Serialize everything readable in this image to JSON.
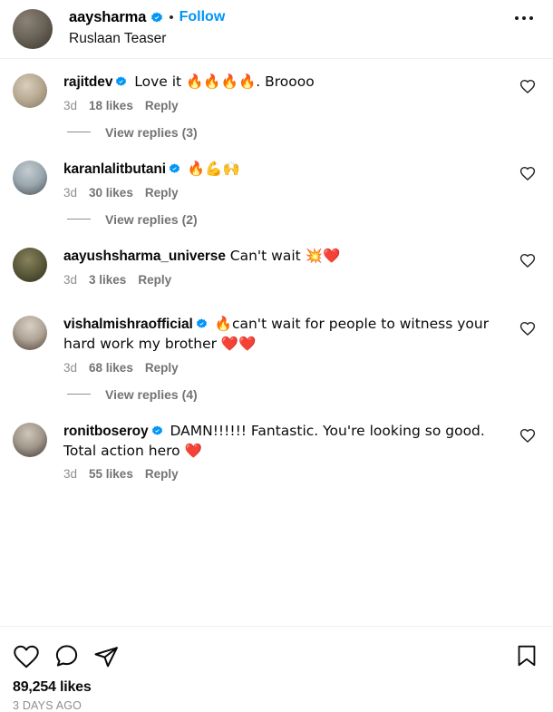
{
  "post": {
    "author": "aaysharma",
    "verified": true,
    "follow_label": "Follow",
    "separator": "•",
    "caption": "Ruslaan Teaser",
    "avatar_colors": [
      "#6b6459",
      "#3a342c",
      "#8c8276"
    ],
    "more_menu_label": "more-options"
  },
  "colors": {
    "link_blue": "#0095f6",
    "verified_blue": "#0095f6",
    "meta_gray": "#737373",
    "time_gray": "#8e8e8e",
    "divider": "#efefef",
    "text_black": "#0a0a0a"
  },
  "comments": [
    {
      "username": "rajitdev",
      "verified": true,
      "text": " Love it 🔥🔥🔥🔥. Broooo",
      "time": "3d",
      "likes": "18 likes",
      "reply": "Reply",
      "avatar_colors": [
        "#b7a890",
        "#7e7565",
        "#d9cfbd"
      ],
      "replies_label": "View replies (3)",
      "has_replies": true
    },
    {
      "username": "karanlalitbutani",
      "verified": true,
      "text": " 🔥💪🙌",
      "time": "3d",
      "likes": "30 likes",
      "reply": "Reply",
      "avatar_colors": [
        "#9aa7ae",
        "#4a4f52",
        "#c3ccd1"
      ],
      "replies_label": "View replies (2)",
      "has_replies": true
    },
    {
      "username": "aayushsharma_universe",
      "verified": false,
      "text": " Can't wait 💥❤️",
      "time": "3d",
      "likes": "3 likes",
      "reply": "Reply",
      "avatar_colors": [
        "#5b5a3a",
        "#2e2d1c",
        "#87825c"
      ],
      "replies_label": "",
      "has_replies": false
    },
    {
      "username": "vishalmishraofficial",
      "verified": true,
      "text": " 🔥can't wait for people to witness your hard work my brother ❤️❤️",
      "time": "3d",
      "likes": "68 likes",
      "reply": "Reply",
      "avatar_colors": [
        "#b0a496",
        "#4f443a",
        "#d8d0c4"
      ],
      "replies_label": "View replies (4)",
      "has_replies": true
    },
    {
      "username": "ronitboseroy",
      "verified": true,
      "text": " DAMN!!!!!! Fantastic. You're looking so good. Total action hero ❤️",
      "time": "3d",
      "likes": "55 likes",
      "reply": "Reply",
      "avatar_colors": [
        "#a0968a",
        "#3b3630",
        "#cfc6ba"
      ],
      "replies_label": "",
      "has_replies": false
    }
  ],
  "footer": {
    "like_icon": "heart-icon",
    "comment_icon": "comment-bubble-icon",
    "share_icon": "share-paperplane-icon",
    "save_icon": "bookmark-icon",
    "likes_count": "89,254 likes",
    "timestamp": "3 DAYS AGO"
  }
}
